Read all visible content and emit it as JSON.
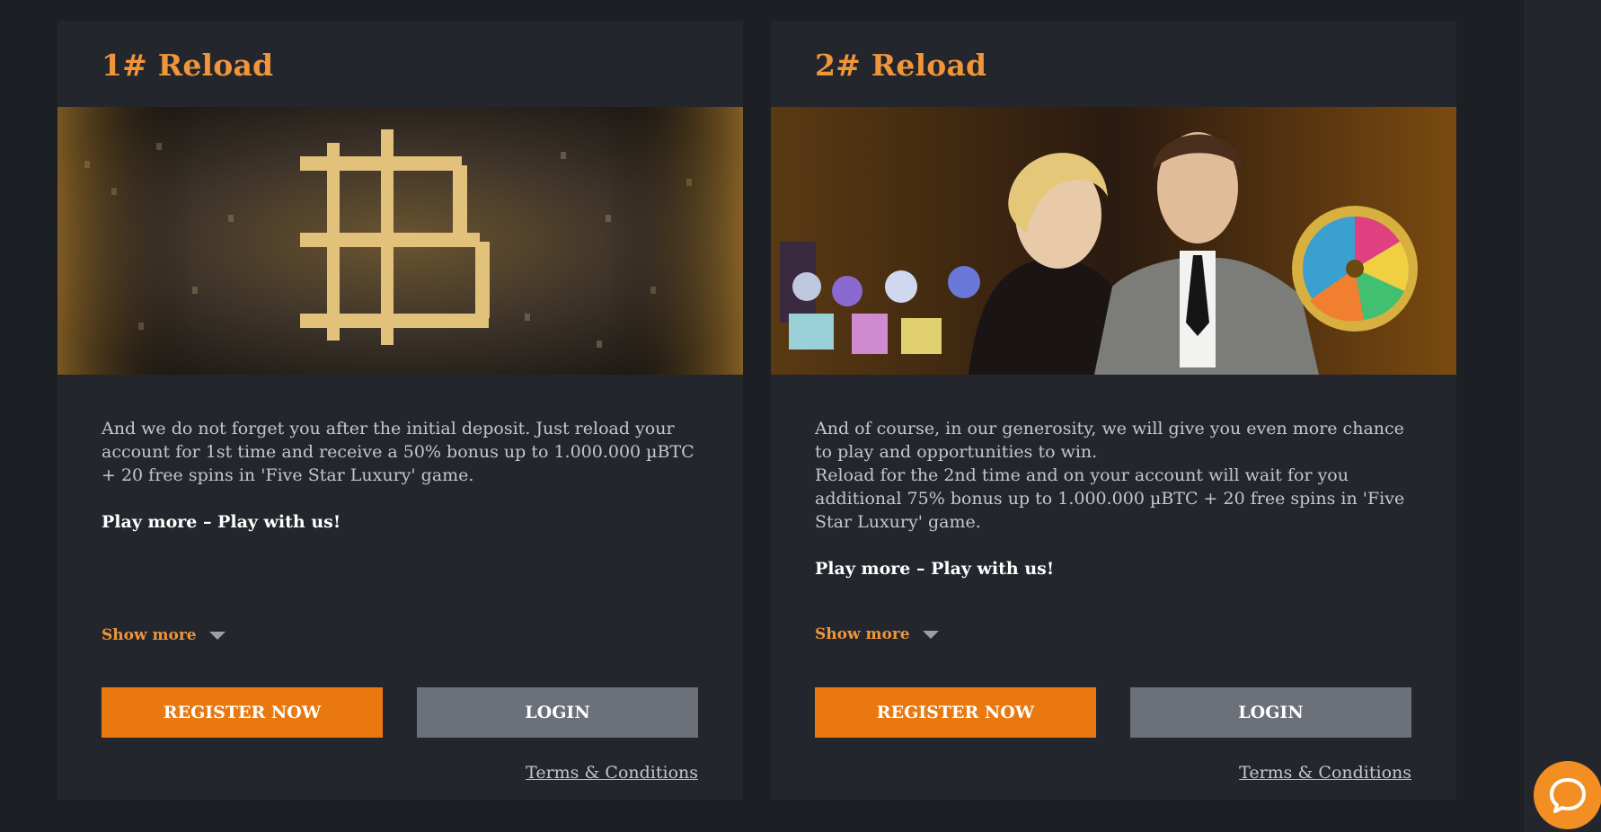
{
  "colors": {
    "accent": "#f0953a",
    "register_button": "#e9780f",
    "login_button": "#6b7079",
    "card_background": "#23262c",
    "page_background": "#1c1f24"
  },
  "cards": [
    {
      "title": "1# Reload",
      "image_icon": "bitcoin-city-image",
      "body": "And we do not forget you after the initial deposit. Just reload your account for 1st time and receive a 50% bonus up to 1.000.000 µBTC + 20 free spins in 'Five Star Luxury' game.",
      "tagline": "Play more – Play with us!",
      "show_more": "Show more",
      "register_label": "REGISTER NOW",
      "login_label": "LOGIN",
      "terms_label": "Terms & Conditions"
    },
    {
      "title": "2# Reload",
      "image_icon": "casino-couple-image",
      "body": "And of course, in our generosity, we will give you even more chance to play and opportunities to win.\nReload for the 2nd time and on your account will wait for you additional 75% bonus up to 1.000.000 µBTC + 20 free spins in 'Five Star Luxury' game.",
      "tagline": "Play more – Play with us!",
      "show_more": "Show more",
      "register_label": "REGISTER NOW",
      "login_label": "LOGIN",
      "terms_label": "Terms & Conditions"
    }
  ],
  "chat": {
    "icon": "chat-bubble-icon"
  }
}
